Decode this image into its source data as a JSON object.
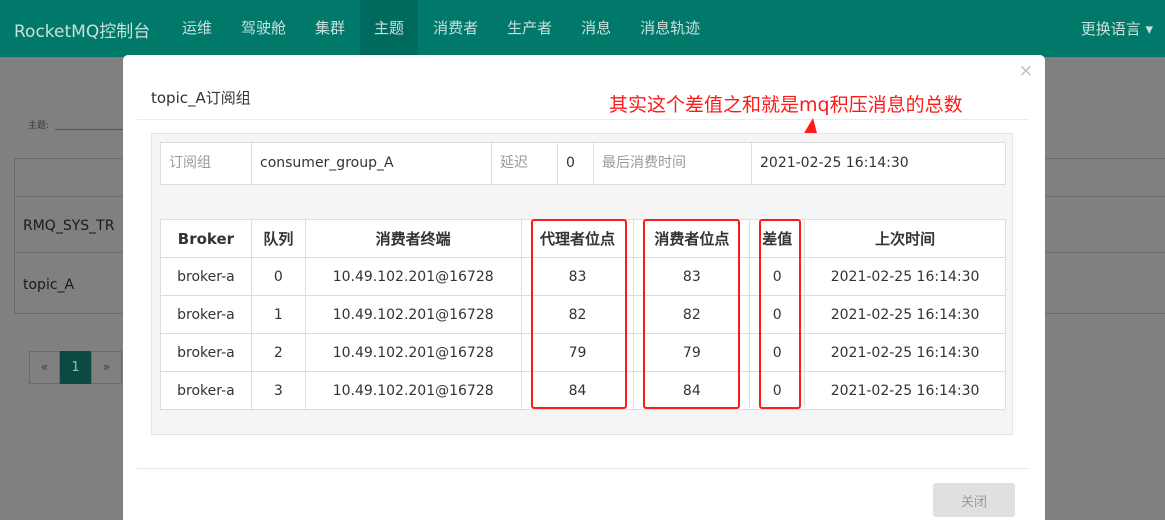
{
  "navbar": {
    "brand": "RocketMQ控制台",
    "items": [
      {
        "label": "运维",
        "active": false
      },
      {
        "label": "驾驶舱",
        "active": false
      },
      {
        "label": "集群",
        "active": false
      },
      {
        "label": "主题",
        "active": true
      },
      {
        "label": "消费者",
        "active": false
      },
      {
        "label": "生产者",
        "active": false
      },
      {
        "label": "消息",
        "active": false
      },
      {
        "label": "消息轨迹",
        "active": false
      }
    ],
    "language": "更换语言 ▾"
  },
  "background": {
    "filter_label": "主题:",
    "rows": [
      "RMQ_SYS_TR",
      "topic_A"
    ],
    "pager": {
      "prev": "«",
      "current": "1",
      "next": "»"
    }
  },
  "modal": {
    "close_glyph": "×",
    "title": "topic_A订阅组",
    "annotation": "其实这个差值之和就是mq积压消息的总数",
    "info": {
      "group_label": "订阅组",
      "group_value": "consumer_group_A",
      "delay_label": "延迟",
      "delay_value": "0",
      "last_consume_label": "最后消费时间",
      "last_consume_value": "2021-02-25 16:14:30"
    },
    "table": {
      "headers": [
        "Broker",
        "队列",
        "消费者终端",
        "代理者位点",
        "消费者位点",
        "差值",
        "上次时间"
      ],
      "rows": [
        [
          "broker-a",
          "0",
          "10.49.102.201@16728",
          "83",
          "83",
          "0",
          "2021-02-25 16:14:30"
        ],
        [
          "broker-a",
          "1",
          "10.49.102.201@16728",
          "82",
          "82",
          "0",
          "2021-02-25 16:14:30"
        ],
        [
          "broker-a",
          "2",
          "10.49.102.201@16728",
          "79",
          "79",
          "0",
          "2021-02-25 16:14:30"
        ],
        [
          "broker-a",
          "3",
          "10.49.102.201@16728",
          "84",
          "84",
          "0",
          "2021-02-25 16:14:30"
        ]
      ]
    },
    "close_button": "关闭"
  },
  "colors": {
    "navbar": "#00796b",
    "annotation": "#ff1a1a"
  }
}
